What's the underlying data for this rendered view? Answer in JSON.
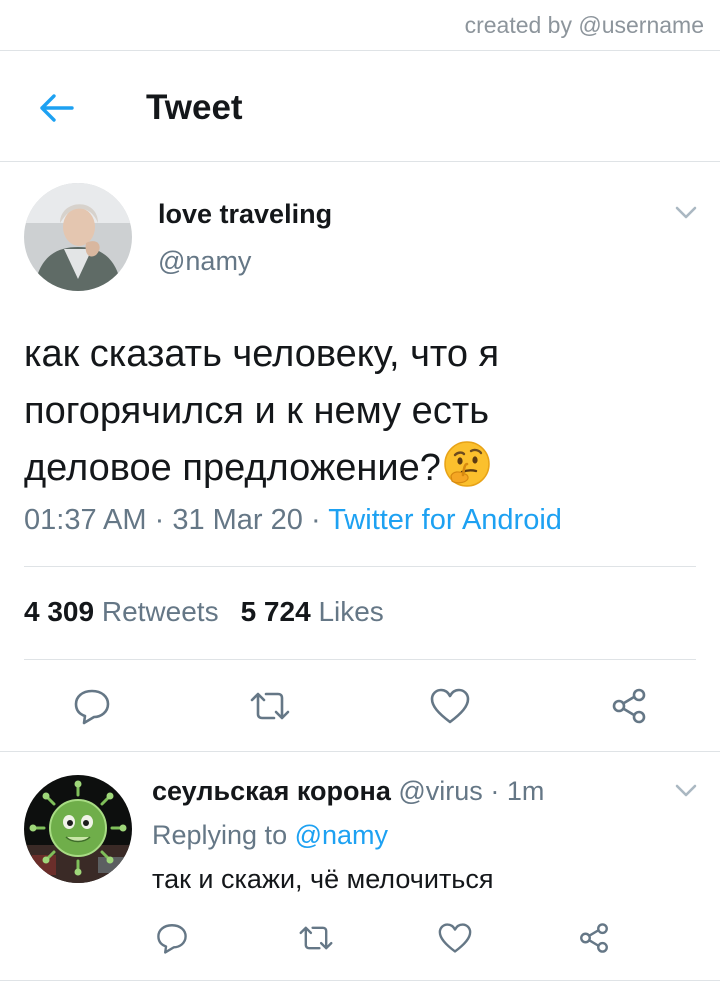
{
  "watermark": "created by @username",
  "header": {
    "title": "Tweet",
    "back_icon": "arrow-left-icon"
  },
  "tweet": {
    "author_name": "love traveling",
    "author_handle": "@namy",
    "text_line1": "как сказать человеку, что я",
    "text_line2": "погорячился и к нему есть",
    "text_line3": "деловое предложение?",
    "emoji": "thinking-face-emoji",
    "time": "01:37 AM",
    "date": "31 Mar 20",
    "sep": "·",
    "source": "Twitter for Android",
    "retweets_count": "4 309",
    "retweets_label": "Retweets",
    "likes_count": "5 724",
    "likes_label": "Likes"
  },
  "reply": {
    "name": "сеульская корона",
    "handle": "@virus",
    "sep": "·",
    "age": "1m",
    "replying_prefix": "Replying to",
    "replying_mention": "@namy",
    "text": "так и скажи, чё мелочиться"
  },
  "colors": {
    "accent": "#1da1f2",
    "secondary_text": "#657786",
    "icon_gray": "#657786",
    "divider": "#dfe3e6"
  }
}
